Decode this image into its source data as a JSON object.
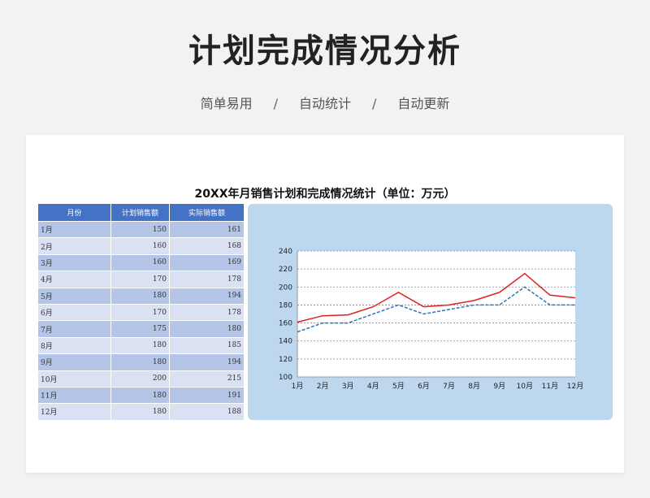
{
  "header": {
    "title": "计划完成情况分析",
    "tags": [
      "简单易用",
      "自动统计",
      "自动更新"
    ],
    "separator": "/"
  },
  "sheet": {
    "title": "20XX年月销售计划和完成情况统计（单位：万元）",
    "columns": [
      "月份",
      "计划销售额",
      "实际销售额"
    ],
    "rows": [
      [
        "1月",
        "150",
        "161"
      ],
      [
        "2月",
        "160",
        "168"
      ],
      [
        "3月",
        "160",
        "169"
      ],
      [
        "4月",
        "170",
        "178"
      ],
      [
        "5月",
        "180",
        "194"
      ],
      [
        "6月",
        "170",
        "178"
      ],
      [
        "7月",
        "175",
        "180"
      ],
      [
        "8月",
        "180",
        "185"
      ],
      [
        "9月",
        "180",
        "194"
      ],
      [
        "10月",
        "200",
        "215"
      ],
      [
        "11月",
        "180",
        "191"
      ],
      [
        "12月",
        "180",
        "188"
      ]
    ]
  },
  "colors": {
    "header_blue": "#4472c4",
    "row_dark": "#b4c5e7",
    "row_light": "#d9e1f2",
    "panel": "#bdd7ee",
    "plan_line": "#2e75b6",
    "actual_line": "#e02020"
  },
  "chart_data": {
    "type": "line",
    "categories": [
      "1月",
      "2月",
      "3月",
      "4月",
      "5月",
      "6月",
      "7月",
      "8月",
      "9月",
      "10月",
      "11月",
      "12月"
    ],
    "series": [
      {
        "name": "",
        "style": "dashed",
        "color": "#2e75b6",
        "values": [
          150,
          160,
          160,
          170,
          180,
          170,
          175,
          180,
          180,
          200,
          180,
          180
        ]
      },
      {
        "name": "",
        "style": "solid",
        "color": "#e02020",
        "values": [
          161,
          168,
          169,
          178,
          194,
          178,
          180,
          185,
          194,
          215,
          191,
          188
        ]
      }
    ],
    "ylim": [
      100,
      240
    ],
    "yticks": [
      100,
      120,
      140,
      160,
      180,
      200,
      220,
      240
    ],
    "grid": true,
    "legend": "none"
  }
}
